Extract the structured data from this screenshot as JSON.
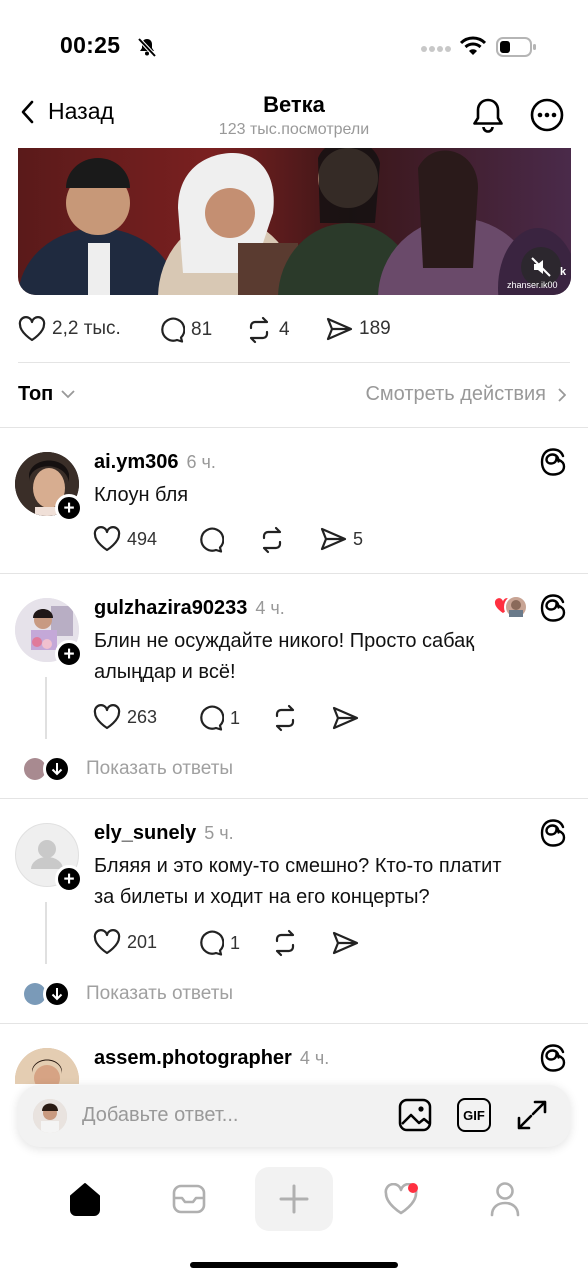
{
  "status_bar": {
    "time": "00:25"
  },
  "header": {
    "back_label": "Назад",
    "title": "Ветка",
    "subtitle": "123 тыс.посмотрели"
  },
  "video": {
    "watermark": "zhanser.ik00",
    "watermark_k": "k"
  },
  "post_stats": {
    "likes": "2,2 тыс.",
    "comments": "81",
    "reposts": "4",
    "shares": "189"
  },
  "sort": {
    "label": "Топ",
    "actions_link": "Смотреть действия"
  },
  "comments": [
    {
      "username": "ai.ym306",
      "time": "6 ч.",
      "text": "Клоун бля",
      "likes": "494",
      "comments": "",
      "reposts": "",
      "shares": "5"
    },
    {
      "username": "gulzhazira90233",
      "time": "4 ч.",
      "text_line1": "Блин не осуждайте никого! Просто сабақ",
      "text_line2": "алыңдар и всё!",
      "likes": "263",
      "comments": "1",
      "show_replies": "Показать ответы"
    },
    {
      "username": "ely_sunely",
      "time": "5 ч.",
      "text_line1": "Бляяя и это кому-то смешно? Кто-то платит",
      "text_line2": "за билеты и ходит на его концерты?",
      "likes": "201",
      "comments": "1",
      "show_replies": "Показать ответы"
    },
    {
      "username": "assem.photographer",
      "time": "4 ч."
    }
  ],
  "reply_bar": {
    "placeholder": "Добавьте ответ...",
    "gif_label": "GIF"
  },
  "colors": {
    "accent_red": "#ff3040",
    "muted": "#999999"
  }
}
